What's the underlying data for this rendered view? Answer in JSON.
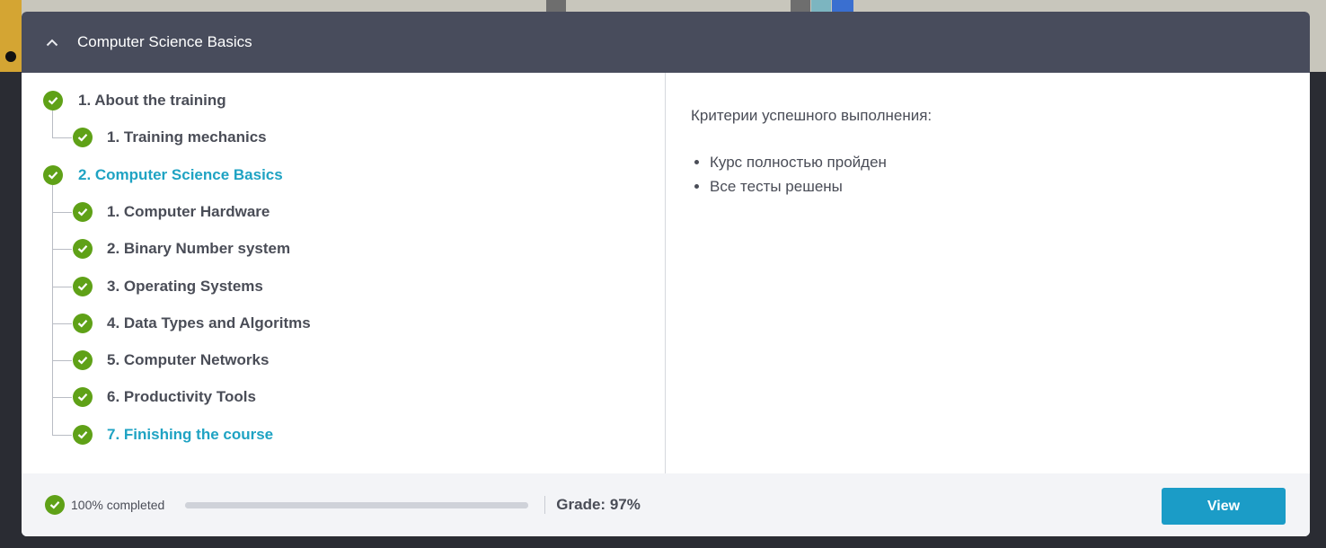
{
  "header": {
    "title": "Computer Science Basics",
    "collapse_icon": "chevron-up-icon"
  },
  "tree": [
    {
      "label": "1. About the training",
      "level": 0,
      "status": "completed",
      "active": false
    },
    {
      "label": "1. Training mechanics",
      "level": 1,
      "status": "completed",
      "active": false
    },
    {
      "label": "2. Computer Science Basics",
      "level": 0,
      "status": "completed",
      "active": true
    },
    {
      "label": "1. Computer Hardware",
      "level": 1,
      "status": "completed",
      "active": false
    },
    {
      "label": "2. Binary Number system",
      "level": 1,
      "status": "completed",
      "active": false
    },
    {
      "label": "3. Operating Systems",
      "level": 1,
      "status": "completed",
      "active": false
    },
    {
      "label": "4. Data Types and Algoritms",
      "level": 1,
      "status": "completed",
      "active": false
    },
    {
      "label": "5. Computer Networks",
      "level": 1,
      "status": "completed",
      "active": false
    },
    {
      "label": "6. Productivity Tools",
      "level": 1,
      "status": "completed",
      "active": false
    },
    {
      "label": "7. Finishing the course",
      "level": 1,
      "status": "completed",
      "active": true
    }
  ],
  "criteria": {
    "title": "Критерии успешного выполнения:",
    "items": [
      "Курс полностью пройден",
      "Все тесты решены"
    ]
  },
  "footer": {
    "progress_text": "100% completed",
    "progress_value": 1.0,
    "grade": "Grade: 97%",
    "view_label": "View"
  },
  "colors": {
    "header_bg": "#484c5c",
    "check_green": "#5fa117",
    "active_link": "#1fa3c3",
    "button_blue": "#1b9cc7"
  }
}
